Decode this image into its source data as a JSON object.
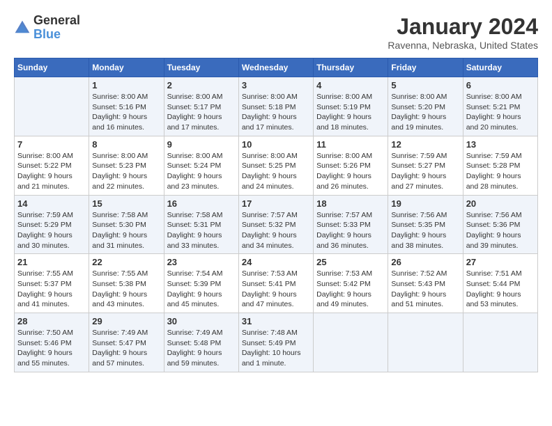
{
  "header": {
    "logo_general": "General",
    "logo_blue": "Blue",
    "month_title": "January 2024",
    "location": "Ravenna, Nebraska, United States"
  },
  "calendar": {
    "days": [
      "Sunday",
      "Monday",
      "Tuesday",
      "Wednesday",
      "Thursday",
      "Friday",
      "Saturday"
    ],
    "rows": [
      [
        {
          "day": "",
          "sunrise": "",
          "sunset": "",
          "daylight": ""
        },
        {
          "day": "1",
          "sunrise": "Sunrise: 8:00 AM",
          "sunset": "Sunset: 5:16 PM",
          "daylight": "Daylight: 9 hours and 16 minutes."
        },
        {
          "day": "2",
          "sunrise": "Sunrise: 8:00 AM",
          "sunset": "Sunset: 5:17 PM",
          "daylight": "Daylight: 9 hours and 17 minutes."
        },
        {
          "day": "3",
          "sunrise": "Sunrise: 8:00 AM",
          "sunset": "Sunset: 5:18 PM",
          "daylight": "Daylight: 9 hours and 17 minutes."
        },
        {
          "day": "4",
          "sunrise": "Sunrise: 8:00 AM",
          "sunset": "Sunset: 5:19 PM",
          "daylight": "Daylight: 9 hours and 18 minutes."
        },
        {
          "day": "5",
          "sunrise": "Sunrise: 8:00 AM",
          "sunset": "Sunset: 5:20 PM",
          "daylight": "Daylight: 9 hours and 19 minutes."
        },
        {
          "day": "6",
          "sunrise": "Sunrise: 8:00 AM",
          "sunset": "Sunset: 5:21 PM",
          "daylight": "Daylight: 9 hours and 20 minutes."
        }
      ],
      [
        {
          "day": "7",
          "sunrise": "Sunrise: 8:00 AM",
          "sunset": "Sunset: 5:22 PM",
          "daylight": "Daylight: 9 hours and 21 minutes."
        },
        {
          "day": "8",
          "sunrise": "Sunrise: 8:00 AM",
          "sunset": "Sunset: 5:23 PM",
          "daylight": "Daylight: 9 hours and 22 minutes."
        },
        {
          "day": "9",
          "sunrise": "Sunrise: 8:00 AM",
          "sunset": "Sunset: 5:24 PM",
          "daylight": "Daylight: 9 hours and 23 minutes."
        },
        {
          "day": "10",
          "sunrise": "Sunrise: 8:00 AM",
          "sunset": "Sunset: 5:25 PM",
          "daylight": "Daylight: 9 hours and 24 minutes."
        },
        {
          "day": "11",
          "sunrise": "Sunrise: 8:00 AM",
          "sunset": "Sunset: 5:26 PM",
          "daylight": "Daylight: 9 hours and 26 minutes."
        },
        {
          "day": "12",
          "sunrise": "Sunrise: 7:59 AM",
          "sunset": "Sunset: 5:27 PM",
          "daylight": "Daylight: 9 hours and 27 minutes."
        },
        {
          "day": "13",
          "sunrise": "Sunrise: 7:59 AM",
          "sunset": "Sunset: 5:28 PM",
          "daylight": "Daylight: 9 hours and 28 minutes."
        }
      ],
      [
        {
          "day": "14",
          "sunrise": "Sunrise: 7:59 AM",
          "sunset": "Sunset: 5:29 PM",
          "daylight": "Daylight: 9 hours and 30 minutes."
        },
        {
          "day": "15",
          "sunrise": "Sunrise: 7:58 AM",
          "sunset": "Sunset: 5:30 PM",
          "daylight": "Daylight: 9 hours and 31 minutes."
        },
        {
          "day": "16",
          "sunrise": "Sunrise: 7:58 AM",
          "sunset": "Sunset: 5:31 PM",
          "daylight": "Daylight: 9 hours and 33 minutes."
        },
        {
          "day": "17",
          "sunrise": "Sunrise: 7:57 AM",
          "sunset": "Sunset: 5:32 PM",
          "daylight": "Daylight: 9 hours and 34 minutes."
        },
        {
          "day": "18",
          "sunrise": "Sunrise: 7:57 AM",
          "sunset": "Sunset: 5:33 PM",
          "daylight": "Daylight: 9 hours and 36 minutes."
        },
        {
          "day": "19",
          "sunrise": "Sunrise: 7:56 AM",
          "sunset": "Sunset: 5:35 PM",
          "daylight": "Daylight: 9 hours and 38 minutes."
        },
        {
          "day": "20",
          "sunrise": "Sunrise: 7:56 AM",
          "sunset": "Sunset: 5:36 PM",
          "daylight": "Daylight: 9 hours and 39 minutes."
        }
      ],
      [
        {
          "day": "21",
          "sunrise": "Sunrise: 7:55 AM",
          "sunset": "Sunset: 5:37 PM",
          "daylight": "Daylight: 9 hours and 41 minutes."
        },
        {
          "day": "22",
          "sunrise": "Sunrise: 7:55 AM",
          "sunset": "Sunset: 5:38 PM",
          "daylight": "Daylight: 9 hours and 43 minutes."
        },
        {
          "day": "23",
          "sunrise": "Sunrise: 7:54 AM",
          "sunset": "Sunset: 5:39 PM",
          "daylight": "Daylight: 9 hours and 45 minutes."
        },
        {
          "day": "24",
          "sunrise": "Sunrise: 7:53 AM",
          "sunset": "Sunset: 5:41 PM",
          "daylight": "Daylight: 9 hours and 47 minutes."
        },
        {
          "day": "25",
          "sunrise": "Sunrise: 7:53 AM",
          "sunset": "Sunset: 5:42 PM",
          "daylight": "Daylight: 9 hours and 49 minutes."
        },
        {
          "day": "26",
          "sunrise": "Sunrise: 7:52 AM",
          "sunset": "Sunset: 5:43 PM",
          "daylight": "Daylight: 9 hours and 51 minutes."
        },
        {
          "day": "27",
          "sunrise": "Sunrise: 7:51 AM",
          "sunset": "Sunset: 5:44 PM",
          "daylight": "Daylight: 9 hours and 53 minutes."
        }
      ],
      [
        {
          "day": "28",
          "sunrise": "Sunrise: 7:50 AM",
          "sunset": "Sunset: 5:46 PM",
          "daylight": "Daylight: 9 hours and 55 minutes."
        },
        {
          "day": "29",
          "sunrise": "Sunrise: 7:49 AM",
          "sunset": "Sunset: 5:47 PM",
          "daylight": "Daylight: 9 hours and 57 minutes."
        },
        {
          "day": "30",
          "sunrise": "Sunrise: 7:49 AM",
          "sunset": "Sunset: 5:48 PM",
          "daylight": "Daylight: 9 hours and 59 minutes."
        },
        {
          "day": "31",
          "sunrise": "Sunrise: 7:48 AM",
          "sunset": "Sunset: 5:49 PM",
          "daylight": "Daylight: 10 hours and 1 minute."
        },
        {
          "day": "",
          "sunrise": "",
          "sunset": "",
          "daylight": ""
        },
        {
          "day": "",
          "sunrise": "",
          "sunset": "",
          "daylight": ""
        },
        {
          "day": "",
          "sunrise": "",
          "sunset": "",
          "daylight": ""
        }
      ]
    ]
  }
}
